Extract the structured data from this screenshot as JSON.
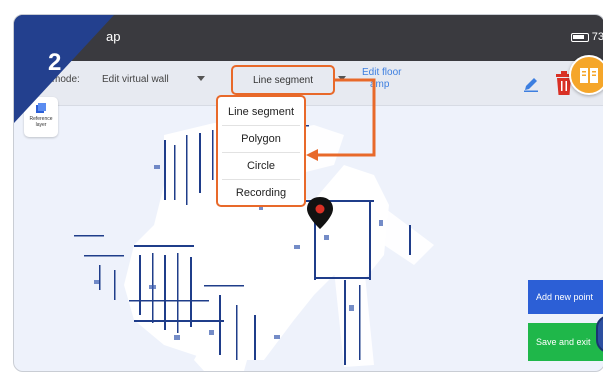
{
  "step": {
    "number": "2"
  },
  "status_bar": {
    "title_fragment": "ap",
    "battery_text": "73"
  },
  "toolbar": {
    "mode_label": "mode:",
    "mode_value": "Edit virtual wall",
    "shape_value": "Line segment",
    "edit_floor_line1": "Edit floor",
    "edit_floor_line2": "amp"
  },
  "reference_layer": {
    "line1": "Reference",
    "line2": "layer"
  },
  "shape_dropdown": {
    "options": [
      "Line segment",
      "Polygon",
      "Circle",
      "Recording"
    ]
  },
  "actions": {
    "add_new_point": "Add new point",
    "save_and_exit": "Save and exit"
  },
  "colors": {
    "highlight": "#e8692a",
    "badge": "#23408e",
    "add_point": "#2c5fd6",
    "save_exit": "#1fb74a",
    "map_points": "#1f3d8a",
    "map_free_space": "#ffffff"
  }
}
